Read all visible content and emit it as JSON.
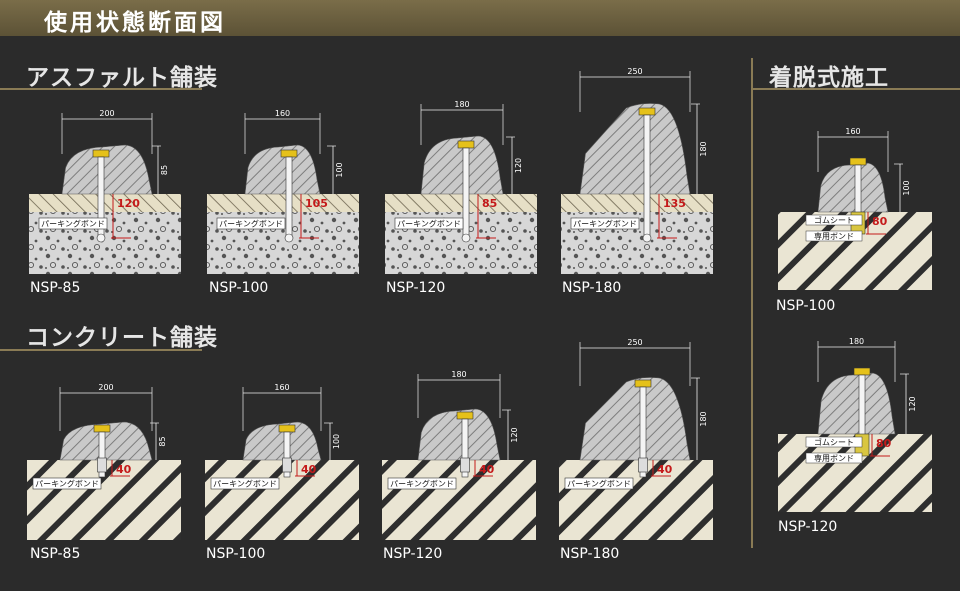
{
  "header": {
    "title": "使用状態断面図"
  },
  "sections": {
    "asphalt": "アスファルト舗装",
    "concrete": "コンクリート舗装",
    "detachable": "着脱式施工"
  },
  "labels": {
    "bond": "パーキングボンド",
    "gum_sheet": "ゴムシート",
    "special_bond": "専用ボンド"
  },
  "asphalt": [
    {
      "model": "NSP-85",
      "width": "200",
      "height": "85",
      "depth": "120"
    },
    {
      "model": "NSP-100",
      "width": "160",
      "height": "100",
      "depth": "105"
    },
    {
      "model": "NSP-120",
      "width": "180",
      "height": "120",
      "depth": "85"
    },
    {
      "model": "NSP-180",
      "width": "250",
      "height": "180",
      "depth": "135"
    }
  ],
  "concrete": [
    {
      "model": "NSP-85",
      "width": "200",
      "height": "85",
      "depth": "40"
    },
    {
      "model": "NSP-100",
      "width": "160",
      "height": "100",
      "depth": "40"
    },
    {
      "model": "NSP-120",
      "width": "180",
      "height": "120",
      "depth": "40"
    },
    {
      "model": "NSP-180",
      "width": "250",
      "height": "180",
      "depth": "40"
    }
  ],
  "detachable": [
    {
      "model": "NSP-100",
      "width": "160",
      "height": "100",
      "depth": "80"
    },
    {
      "model": "NSP-120",
      "width": "180",
      "height": "120",
      "depth": "80"
    }
  ],
  "colors": {
    "header_bg": "#6b603f",
    "accent_line": "#8a7b55",
    "bg": "#2b2b2b",
    "dimension_red": "#c41a1a",
    "ground": "#e9e4d2",
    "block": "#bdbdbd"
  }
}
